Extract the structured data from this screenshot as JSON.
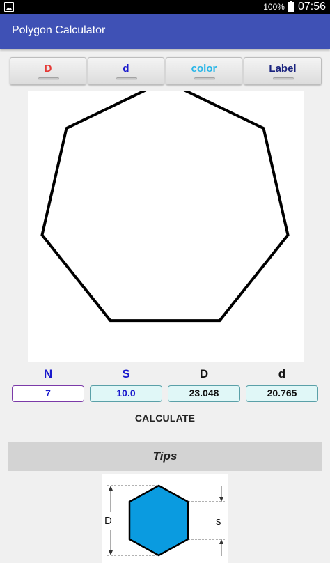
{
  "status_bar": {
    "battery_percent": "100%",
    "time": "07:56",
    "left_icon": "gallery-notification-icon",
    "battery_icon": "battery-icon"
  },
  "app_bar": {
    "title": "Polygon Calculator",
    "background_color": "#3f51b5"
  },
  "toggles": [
    {
      "label": "D",
      "color": "#e53935"
    },
    {
      "label": "d",
      "color": "#1a1acc"
    },
    {
      "label": "color",
      "color": "#29b6e8"
    },
    {
      "label": "Label",
      "color": "#1a237e"
    }
  ],
  "polygon": {
    "sides": 7,
    "stroke_color": "#000000",
    "fill_color": "#ffffff"
  },
  "params": {
    "headers": {
      "n": "N",
      "s": "S",
      "big_d": "D",
      "small_d": "d"
    },
    "header_colors": {
      "n": "#1a1acc",
      "s": "#1a1acc",
      "big_d": "#111111",
      "small_d": "#111111"
    },
    "values": {
      "n": "7",
      "s": "10.0",
      "big_d": "23.048",
      "small_d": "20.765"
    }
  },
  "calculate_label": "CALCULATE",
  "tips": {
    "title": "Tips",
    "diagram": {
      "label_d": "D",
      "label_s": "s",
      "hexagon_color": "#0a9be0"
    }
  }
}
